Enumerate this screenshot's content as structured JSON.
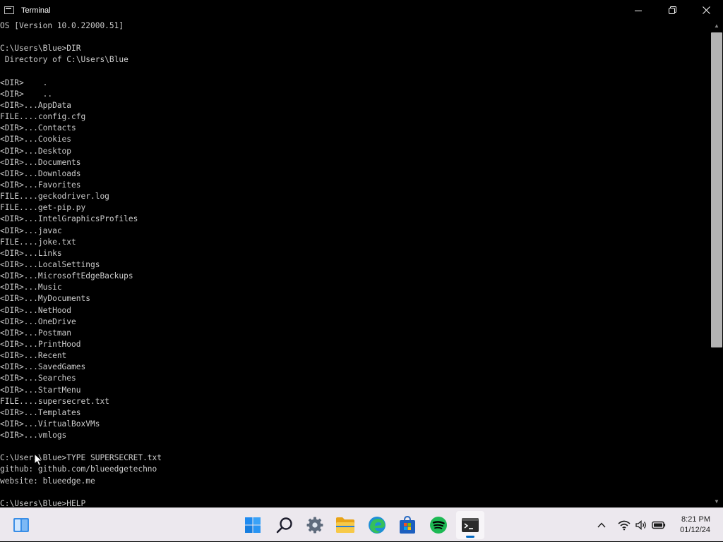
{
  "window": {
    "title": "Terminal",
    "controls": [
      "minimize",
      "maximize",
      "close"
    ]
  },
  "console": {
    "lines": [
      "OS [Version 10.0.22000.51]",
      "",
      "C:\\Users\\Blue>DIR",
      " Directory of C:\\Users\\Blue",
      "",
      "<DIR>    .",
      "<DIR>    ..",
      "<DIR>...AppData",
      "FILE....config.cfg",
      "<DIR>...Contacts",
      "<DIR>...Cookies",
      "<DIR>...Desktop",
      "<DIR>...Documents",
      "<DIR>...Downloads",
      "<DIR>...Favorites",
      "FILE....geckodriver.log",
      "FILE....get-pip.py",
      "<DIR>...IntelGraphicsProfiles",
      "<DIR>...javac",
      "FILE....joke.txt",
      "<DIR>...Links",
      "<DIR>...LocalSettings",
      "<DIR>...MicrosoftEdgeBackups",
      "<DIR>...Music",
      "<DIR>...MyDocuments",
      "<DIR>...NetHood",
      "<DIR>...OneDrive",
      "<DIR>...Postman",
      "<DIR>...PrintHood",
      "<DIR>...Recent",
      "<DIR>...SavedGames",
      "<DIR>...Searches",
      "<DIR>...StartMenu",
      "FILE....supersecret.txt",
      "<DIR>...Templates",
      "<DIR>...VirtualBoxVMs",
      "<DIR>...vmlogs",
      "",
      "C:\\Users\\Blue>TYPE SUPERSECRET.txt",
      "github: github.com/blueedgetechno",
      "website: blueedge.me",
      "",
      "C:\\Users\\Blue>HELP"
    ]
  },
  "taskbar": {
    "apps": [
      {
        "name": "widgets-icon"
      },
      {
        "name": "start-icon"
      },
      {
        "name": "search-icon"
      },
      {
        "name": "settings-icon"
      },
      {
        "name": "file-explorer-icon"
      },
      {
        "name": "edge-icon"
      },
      {
        "name": "store-icon"
      },
      {
        "name": "spotify-icon"
      },
      {
        "name": "terminal-icon",
        "active": true
      }
    ],
    "tray": {
      "icons": [
        "chevron-up-icon",
        "wifi-icon",
        "volume-icon",
        "battery-icon"
      ],
      "time": "8:21 PM",
      "date": "01/12/24"
    }
  },
  "colors": {
    "console_bg": "#000000",
    "console_text": "#cccccc",
    "taskbar_bg": "#ece8ee",
    "accent": "#0067c0"
  }
}
